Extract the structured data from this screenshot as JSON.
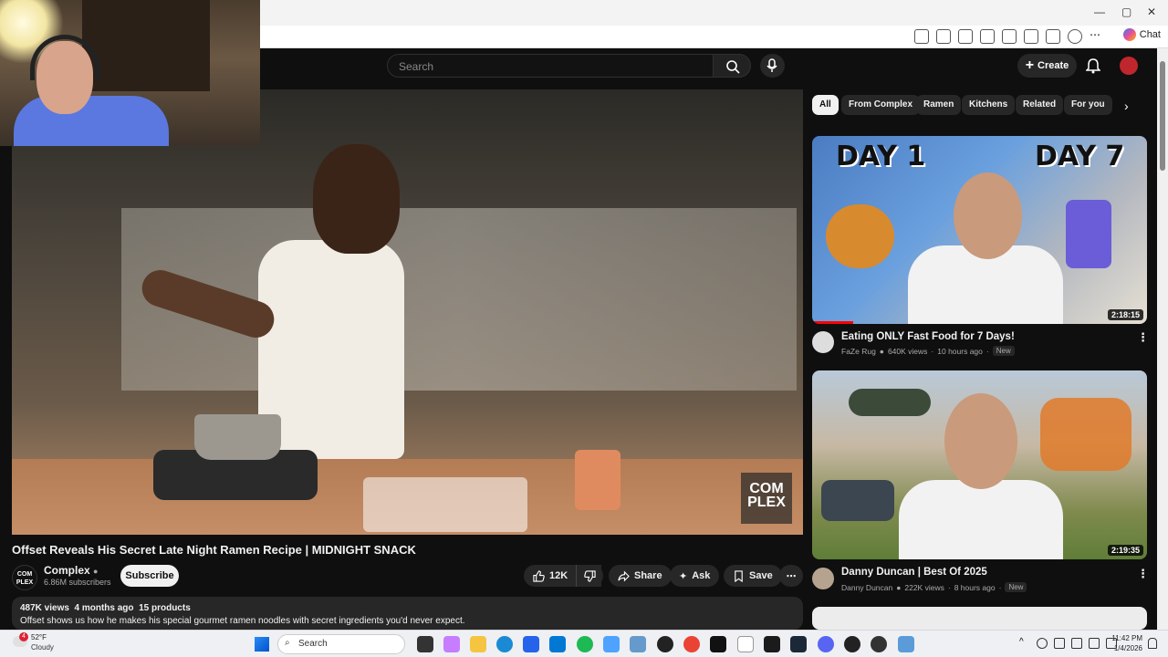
{
  "browser": {
    "chat_label": "Chat",
    "win_min": "—",
    "win_max": "▢",
    "win_close": "✕"
  },
  "header": {
    "search_placeholder": "Search",
    "create_label": "Create"
  },
  "video": {
    "title": "Offset Reveals His Secret Late Night Ramen Recipe | MIDNIGHT SNACK",
    "watermark": "COM PLEX",
    "channel": {
      "name": "Complex",
      "subscribers": "6.86M subscribers",
      "avatar_text": "COM PLEX"
    },
    "subscribe_label": "Subscribe",
    "actions": {
      "likes": "12K",
      "share": "Share",
      "ask": "Ask",
      "save": "Save"
    },
    "description": {
      "views": "487K views",
      "age": "4 months ago",
      "products": "15 products",
      "text": "Offset shows us how he makes his special gourmet ramen noodles with secret ingredients you'd never expect."
    }
  },
  "chips": [
    "All",
    "From Complex",
    "Ramen",
    "Kitchens",
    "Related",
    "For you"
  ],
  "related": [
    {
      "title": "Eating ONLY Fast Food for 7 Days!",
      "channel": "FaZe Rug",
      "views": "640K views",
      "age": "10 hours ago",
      "badge": "New",
      "duration": "2:18:15",
      "thumb_text_left": "DAY 1",
      "thumb_text_right": "DAY 7"
    },
    {
      "title": "Danny Duncan | Best Of 2025",
      "channel": "Danny Duncan",
      "views": "222K views",
      "age": "8 hours ago",
      "badge": "New",
      "duration": "2:19:35"
    }
  ],
  "taskbar": {
    "temperature": "52°F",
    "condition": "Cloudy",
    "weather_badge": "4",
    "search_label": "Search",
    "time": "11:42 PM",
    "date": "1/4/2026"
  },
  "colors": {
    "accent_red": "#ff0000",
    "background": "#0f0f0f",
    "chip_active": "#f1f1f1"
  }
}
